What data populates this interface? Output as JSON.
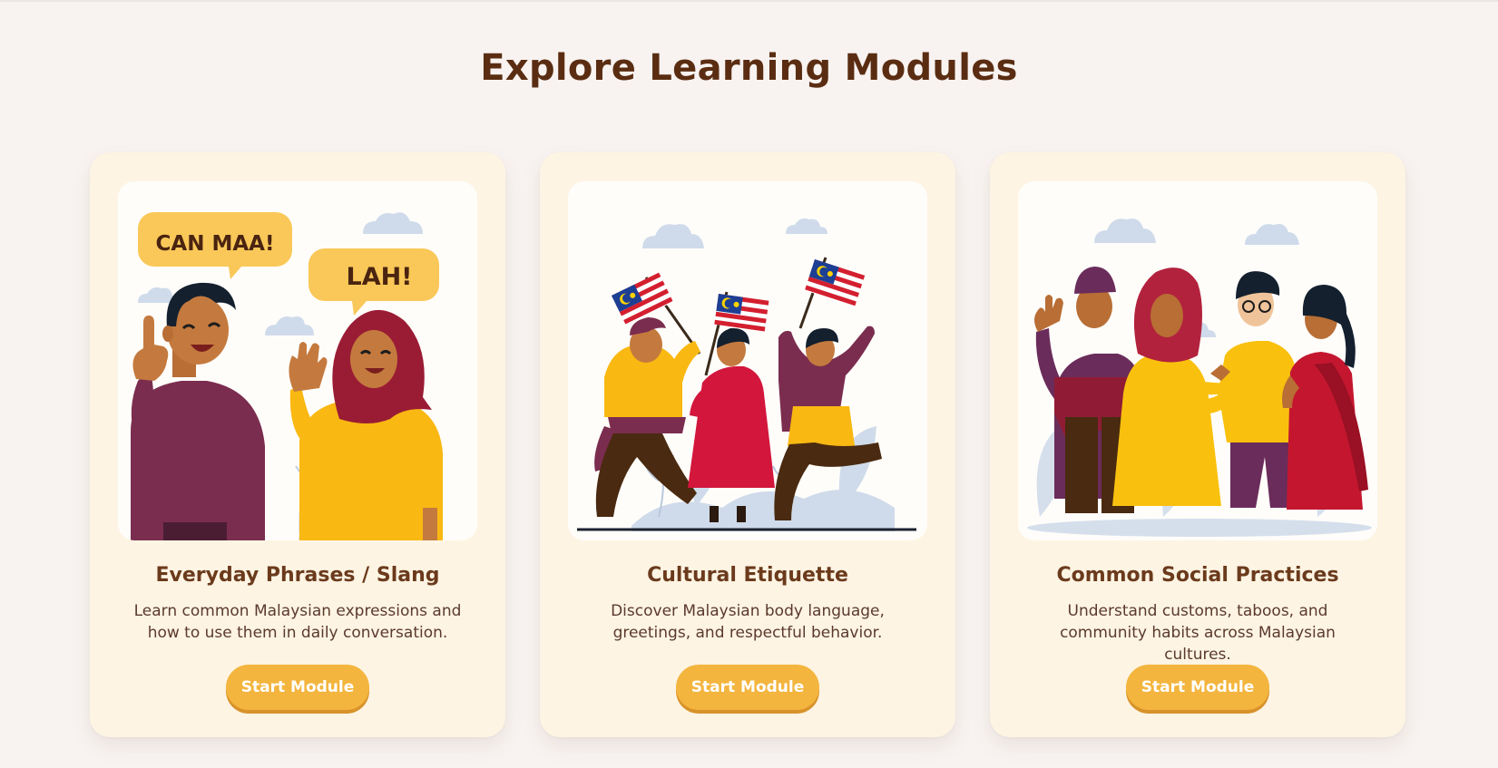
{
  "page": {
    "title": "Explore Learning Modules"
  },
  "colors": {
    "background": "#f8f3f1",
    "card_background": "#fdf4e3",
    "title": "#5a2d12",
    "button": "#f3b53e"
  },
  "modules": [
    {
      "title": "Everyday Phrases / Slang",
      "description": "Learn common Malaysian expressions and how to use them in daily conversation.",
      "button_label": "Start Module",
      "illustration": {
        "icon": "two-people-chatting-illustration",
        "bubbles": [
          "CAN MAA!",
          "LAH!"
        ]
      }
    },
    {
      "title": "Cultural Etiquette",
      "description": "Discover Malaysian body language, greetings, and respectful behavior.",
      "button_label": "Start Module",
      "illustration": {
        "icon": "people-waving-malaysian-flags-illustration"
      }
    },
    {
      "title": "Common Social Practices",
      "description": "Understand customs, taboos, and community habits across Malaysian cultures.",
      "button_label": "Start Module",
      "illustration": {
        "icon": "diverse-group-greeting-illustration"
      }
    }
  ]
}
